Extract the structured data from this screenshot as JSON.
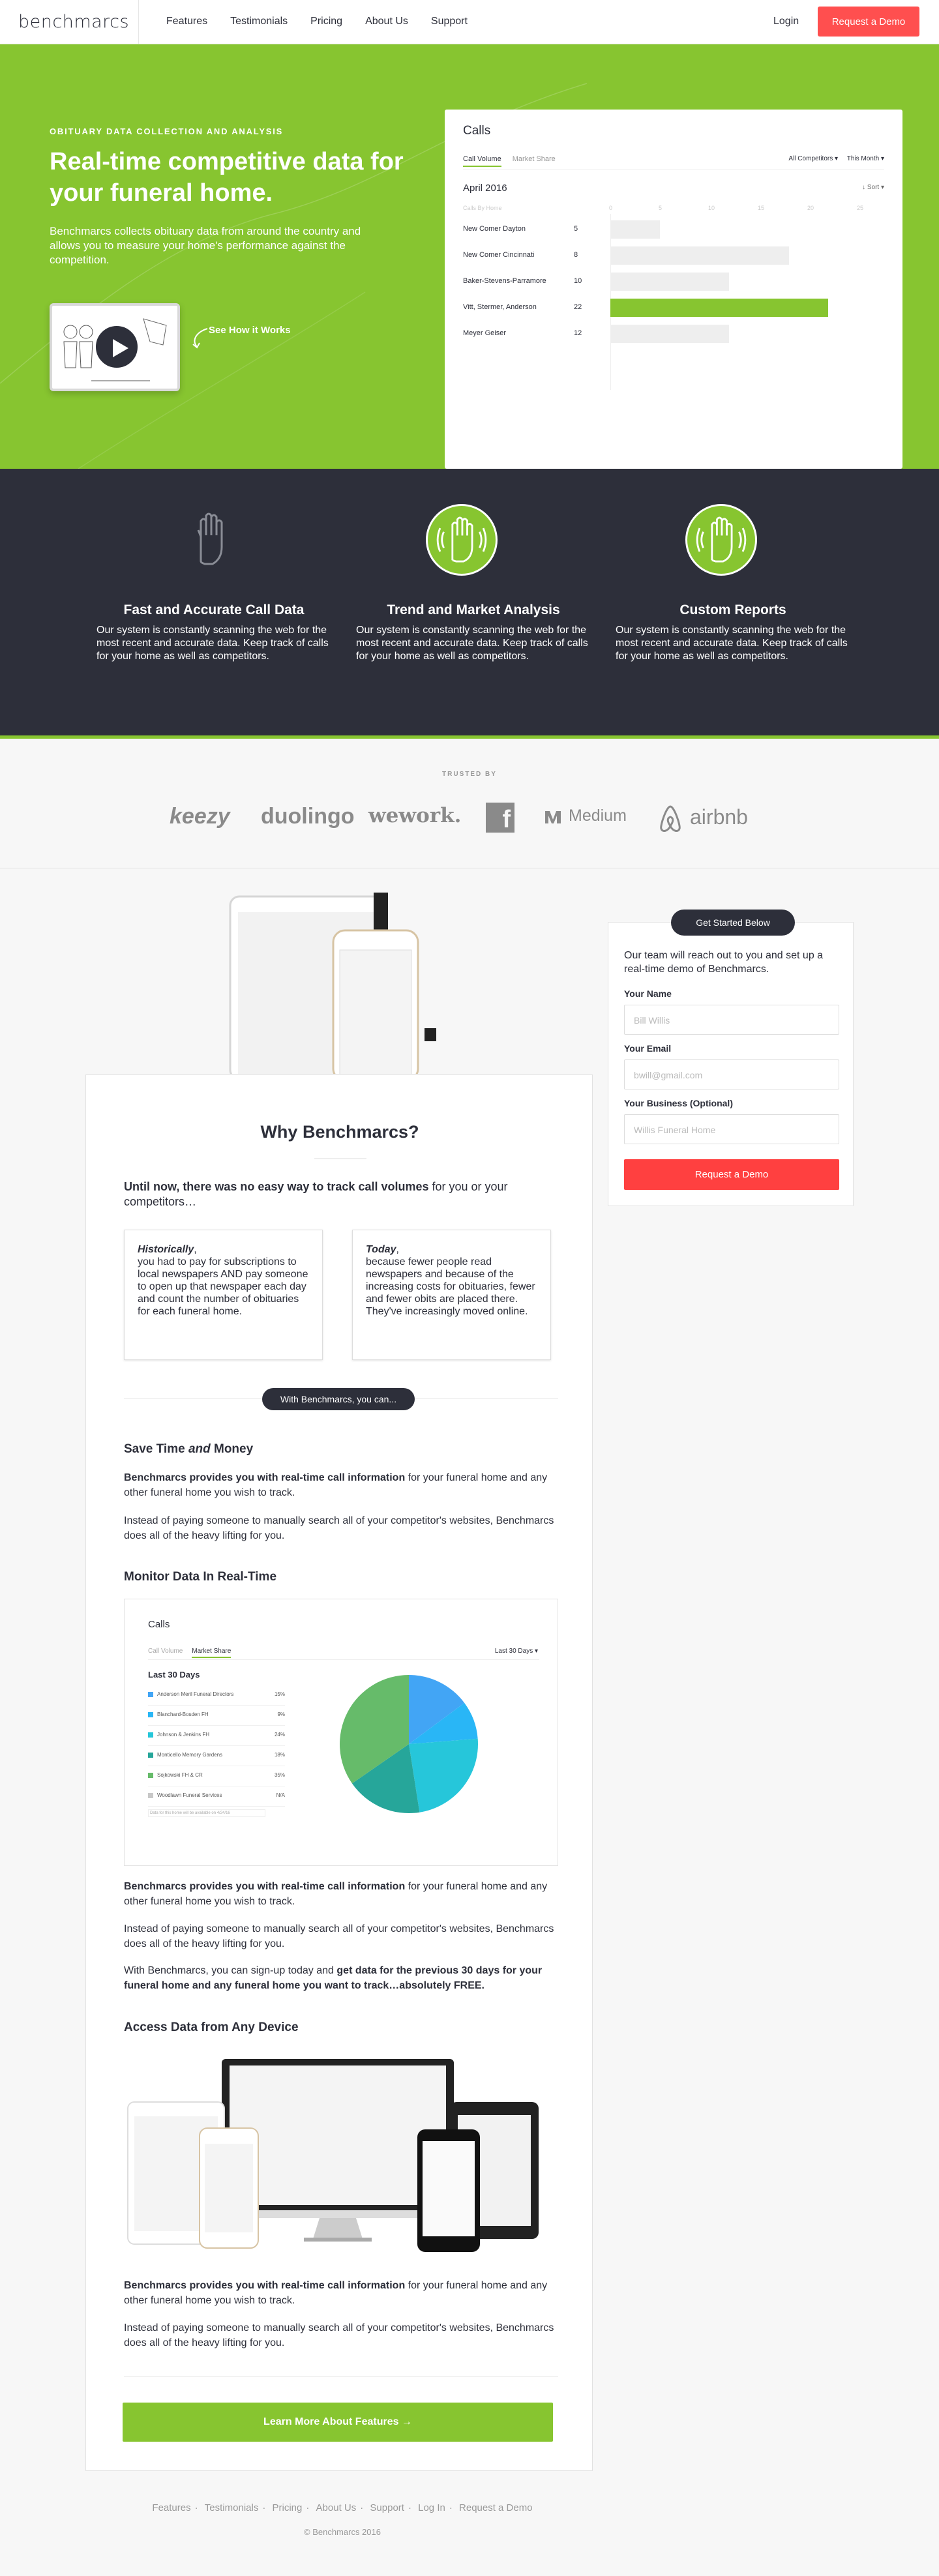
{
  "brand": {
    "logo": "benchmarcs",
    "green": "#87c530",
    "dark": "#2d2f3a",
    "red": "#ff4f4f"
  },
  "nav": {
    "links": [
      "Features",
      "Testimonials",
      "Pricing",
      "About Us",
      "Support"
    ],
    "login": "Login",
    "demo": "Request a Demo"
  },
  "hero": {
    "eyebrow": "OBITUARY DATA COLLECTION AND ANALYSIS",
    "title": "Real-time competitive data for your funeral home.",
    "desc": "Benchmarcs collects obituary data from around the country and allows you to measure your home's performance against the competition.",
    "see_how": "See How it Works",
    "play_icon": "play-icon"
  },
  "calls": {
    "title": "Calls",
    "tabs": [
      "Call Volume",
      "Market Share"
    ],
    "filter_competitors": "All Competitors ▾",
    "filter_period": "This Month ▾",
    "month": "April 2016",
    "sort": "↓ Sort ▾",
    "col_header": "Calls By Home"
  },
  "chart_data": {
    "type": "bar",
    "categories": [
      "New Comer Dayton",
      "New Comer Cincinnati",
      "Baker-Stevens-Parramore",
      "Vitt, Stermer, Anderson",
      "Meyer Geiser"
    ],
    "values": [
      5,
      18,
      12,
      22,
      12
    ],
    "value_labels": [
      "5",
      "8",
      "10",
      "22",
      "12"
    ],
    "xticks": [
      0,
      5,
      10,
      15,
      20,
      25
    ],
    "xlim": [
      0,
      25
    ],
    "highlight_index": 3
  },
  "features": [
    {
      "icon": "hand-icon",
      "title": "Fast and Accurate Call Data",
      "text": "Our system is constantly scanning the web for the most recent and accurate data. Keep track of calls for your home as well as competitors."
    },
    {
      "icon": "hand-waves-icon",
      "title": "Trend and Market Analysis",
      "text": "Our system is constantly scanning the web for the most recent and accurate data. Keep track of calls for your home as well as competitors."
    },
    {
      "icon": "hand-waves-icon",
      "title": "Custom Reports",
      "text": "Our system is constantly scanning the web for the most recent and accurate data. Keep track of calls for your home as well as competitors."
    }
  ],
  "trusted": {
    "label": "TRUSTED BY",
    "logos": [
      "keezy",
      "duolingo",
      "wework.",
      "f",
      "Medium",
      "airbnb"
    ]
  },
  "why": {
    "title": "Why Benchmarcs?",
    "lead_bold": "Until now, there was no easy way to track call volumes",
    "lead_rest": " for you or your competitors…",
    "hist_title": "Historically",
    "hist_text": "you had to pay for subscriptions to local newspapers AND pay someone to open up that newspaper each day and count the number of obituaries for each funeral home.",
    "today_title": "Today",
    "today_text": "because fewer people read newspapers and because of the increasing costs for obituaries, fewer and fewer obits are placed there. They've increasingly moved online.",
    "pill": "With Benchmarcs, you can...",
    "save_title_a": "Save Time ",
    "save_title_b": "and",
    "save_title_c": " Money",
    "p1_bold": "Benchmarcs provides you with real-time call information",
    "p1_rest": " for your funeral home and any other funeral home you wish to track.",
    "p2": "Instead of paying someone to manually search all of your competitor's websites, Benchmarcs does all of the heavy lifting for you.",
    "monitor_title": "Monitor Data In Real-Time",
    "p3_a": "With Benchmarcs, you can sign-up today and ",
    "p3_bold": "get data for the previous 30 days for your funeral home and any funeral home you want to track…absolutely FREE.",
    "access_title": "Access Data from Any Device",
    "learn": "Learn More About Features  →"
  },
  "share": {
    "title": "Calls",
    "tabs": [
      "Call Volume",
      "Market Share"
    ],
    "period": "Last 30 Days ▾",
    "heading": "Last 30 Days",
    "legend": [
      {
        "name": "Anderson Meril Funeral Directors",
        "pct": "15%",
        "color": "#42a5f5"
      },
      {
        "name": "Blanchard-Bosden FH",
        "pct": "9%",
        "color": "#29b6f6"
      },
      {
        "name": "Johnson & Jenkins FH",
        "pct": "24%",
        "color": "#26c6da"
      },
      {
        "name": "Monticello Memory Gardens",
        "pct": "18%",
        "color": "#26a69a"
      },
      {
        "name": "Sojkowski FH & CR",
        "pct": "35%",
        "color": "#66bb6a"
      },
      {
        "name": "Woodlawn Funeral Services",
        "pct": "N/A",
        "color": "#c8c8c8"
      }
    ],
    "footnote": "Data for this home will be available on 4/24/16"
  },
  "form": {
    "badge": "Get Started Below",
    "intro": "Our team will reach out to you and set up a real-time demo of Benchmarcs.",
    "name_label": "Your Name",
    "name_ph": "Bill Willis",
    "email_label": "Your Email",
    "email_ph": "bwill@gmail.com",
    "business_label": "Your Business (Optional)",
    "business_ph": "Willis Funeral Home",
    "submit": "Request a Demo"
  },
  "footer": {
    "links": [
      "Features",
      "Testimonials",
      "Pricing",
      "About Us",
      "Support",
      "Log In",
      "Request a Demo"
    ],
    "copy": "© Benchmarcs 2016"
  }
}
